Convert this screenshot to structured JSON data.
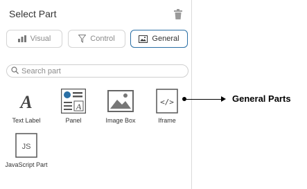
{
  "panel": {
    "title": "Select Part",
    "tabs": [
      {
        "label": "Visual",
        "icon": "bar-chart-icon",
        "active": false
      },
      {
        "label": "Control",
        "icon": "funnel-filter-icon",
        "active": false
      },
      {
        "label": "General",
        "icon": "image-frame-icon",
        "active": true
      }
    ],
    "search": {
      "placeholder": "Search part",
      "value": ""
    },
    "parts": [
      {
        "label": "Text Label",
        "icon": "text-label-icon"
      },
      {
        "label": "Panel",
        "icon": "panel-icon"
      },
      {
        "label": "Image Box",
        "icon": "image-box-icon"
      },
      {
        "label": "Iframe",
        "icon": "iframe-code-icon"
      },
      {
        "label": "JavaScript Part",
        "icon": "javascript-icon"
      }
    ]
  },
  "annotation": {
    "label": "General Parts"
  },
  "colors": {
    "accent": "#2a6fa5",
    "border": "#d4d4d4",
    "icon_gray": "#555555"
  }
}
